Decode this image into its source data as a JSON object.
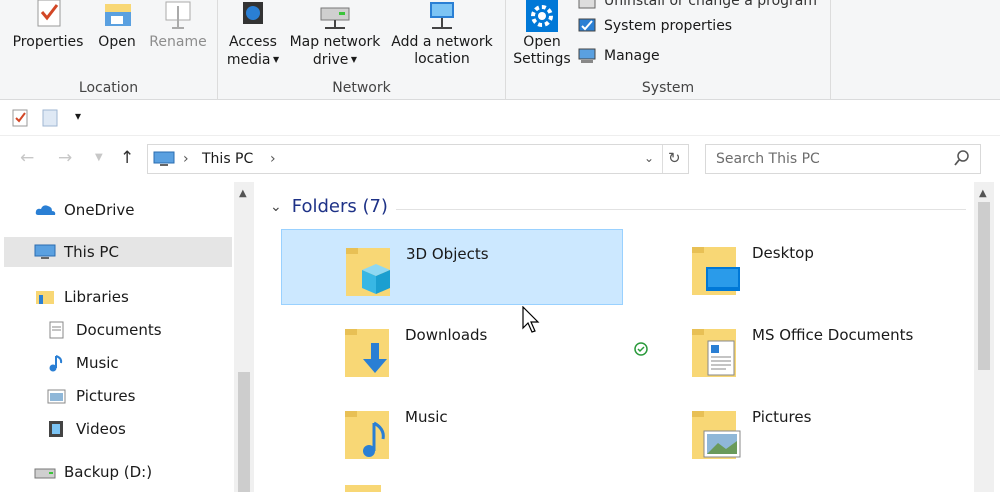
{
  "ribbon": {
    "location": {
      "label": "Location",
      "properties": "Properties",
      "open": "Open",
      "rename": "Rename"
    },
    "network": {
      "label": "Network",
      "access_media": [
        "Access",
        "media"
      ],
      "map_network_drive": [
        "Map network",
        "drive"
      ],
      "add_network_location": [
        "Add a network",
        "location"
      ]
    },
    "system": {
      "label": "System",
      "open_settings": [
        "Open",
        "Settings"
      ],
      "uninstall": "Uninstall or change a program",
      "system_properties": "System properties",
      "manage": "Manage"
    }
  },
  "qat": {
    "dropdown": "▾"
  },
  "address": {
    "crumb": "This PC",
    "sep": "›",
    "search_placeholder": "Search This PC"
  },
  "nav": {
    "onedrive": "OneDrive",
    "this_pc": "This PC",
    "libraries": "Libraries",
    "documents": "Documents",
    "music": "Music",
    "pictures": "Pictures",
    "videos": "Videos",
    "backup": "Backup (D:)"
  },
  "content": {
    "group_title": "Folders (7)",
    "folders": [
      {
        "name": "3D Objects"
      },
      {
        "name": "Desktop"
      },
      {
        "name": "Downloads"
      },
      {
        "name": "MS Office Documents"
      },
      {
        "name": "Music"
      },
      {
        "name": "Pictures"
      }
    ]
  },
  "colors": {
    "accent": "#0078d7",
    "selection": "#cce8ff",
    "folder": "#f8d775",
    "group_header": "#1e3287",
    "sync_check": "#2b9a3c"
  }
}
